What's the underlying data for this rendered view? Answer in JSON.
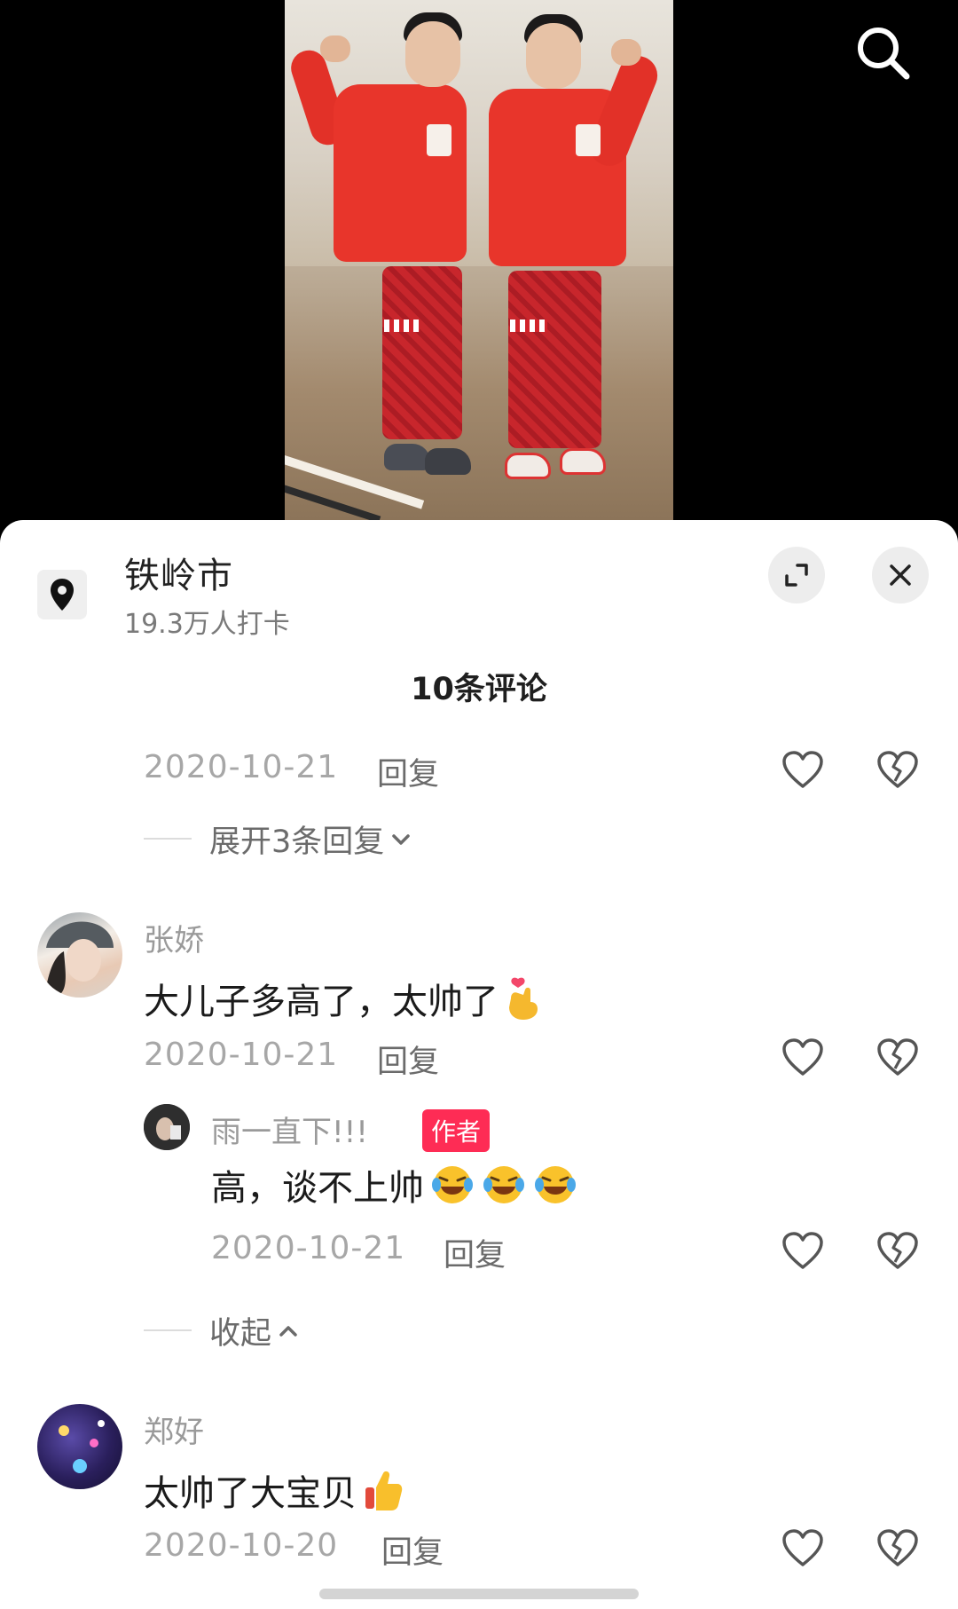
{
  "location": {
    "name": "铁岭市",
    "checkins": "19.3万人打卡"
  },
  "comments_header": {
    "count_label": "10条评论"
  },
  "comments": [
    {
      "date": "2020-10-21",
      "reply_label": "回复",
      "expand_label": "展开3条回复"
    },
    {
      "username": "张娇",
      "text": "大儿子多高了，太帅了",
      "emoji": "finger-heart-icon",
      "date": "2020-10-21",
      "reply_label": "回复",
      "replies": [
        {
          "username": "雨一直下!!!",
          "badge": "作者",
          "text": "高，谈不上帅",
          "emoji": "rolling-laughing-icon",
          "date": "2020-10-21",
          "reply_label": "回复"
        }
      ],
      "collapse_label": "收起"
    },
    {
      "username": "郑好",
      "text": "太帅了大宝贝",
      "emoji": "thumbs-up-icon",
      "date": "2020-10-20",
      "reply_label": "回复"
    }
  ],
  "colors": {
    "accent": "#fe2c55",
    "sheet_bg": "#ffffff",
    "muted_text": "#a7a7a7"
  }
}
